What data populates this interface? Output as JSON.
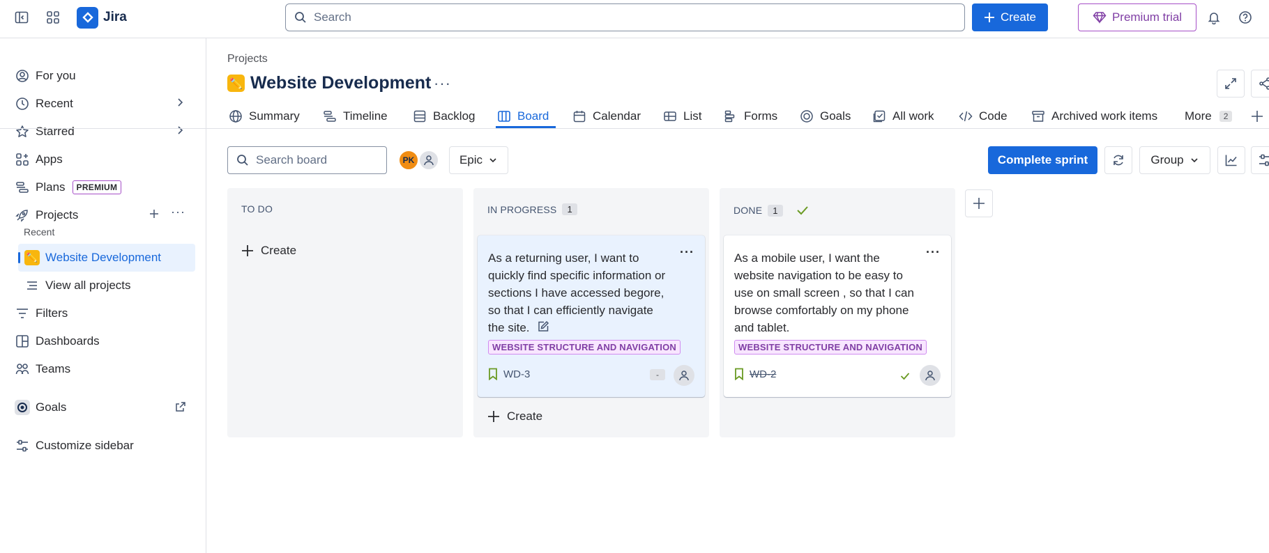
{
  "topbar": {
    "app_name": "Jira",
    "search_placeholder": "Search",
    "create_label": "Create",
    "premium_label": "Premium trial"
  },
  "sidebar": {
    "items": [
      {
        "label": "For you"
      },
      {
        "label": "Recent"
      },
      {
        "label": "Starred"
      },
      {
        "label": "Apps"
      },
      {
        "label": "Plans",
        "badge": "PREMIUM"
      },
      {
        "label": "Projects"
      }
    ],
    "recent_header": "Recent",
    "active_project": "Website Development",
    "view_all": "View all projects",
    "items2": [
      {
        "label": "Filters"
      },
      {
        "label": "Dashboards"
      },
      {
        "label": "Teams"
      },
      {
        "label": "Goals"
      },
      {
        "label": "Customize sidebar"
      }
    ]
  },
  "header": {
    "breadcrumb": "Projects",
    "title": "Website Development"
  },
  "tabs": [
    {
      "label": "Summary"
    },
    {
      "label": "Timeline"
    },
    {
      "label": "Backlog"
    },
    {
      "label": "Board"
    },
    {
      "label": "Calendar"
    },
    {
      "label": "List"
    },
    {
      "label": "Forms"
    },
    {
      "label": "Goals"
    },
    {
      "label": "All work"
    },
    {
      "label": "Code"
    },
    {
      "label": "Archived work items"
    },
    {
      "label": "More",
      "count": "2"
    }
  ],
  "toolbar": {
    "search_placeholder": "Search board",
    "avatar_initials": "PK",
    "epic_label": "Epic",
    "complete_sprint": "Complete sprint",
    "group_label": "Group"
  },
  "columns": [
    {
      "name": "TO DO",
      "create": "Create"
    },
    {
      "name": "IN PROGRESS",
      "count": "1",
      "create": "Create"
    },
    {
      "name": "DONE",
      "count": "1"
    }
  ],
  "cards": [
    {
      "text": "As a returning user, I want to quickly find specific information or sections I have accessed begore, so that I can efficiently navigate the site.",
      "label": "WEBSITE STRUCTURE AND NAVIGATION",
      "key": "WD-3",
      "estimate": "-"
    },
    {
      "text": "As a mobile user, I want the website navigation to be easy to use on small screen , so that I can browse comfortably on my phone and tablet.",
      "label": "WEBSITE STRUCTURE AND NAVIGATION",
      "key": "WD-2"
    }
  ],
  "colors": {
    "accent": "#1868db",
    "premium": "#803fa5",
    "label_bg": "#f8e6ff",
    "done_check": "#6a9a23"
  }
}
